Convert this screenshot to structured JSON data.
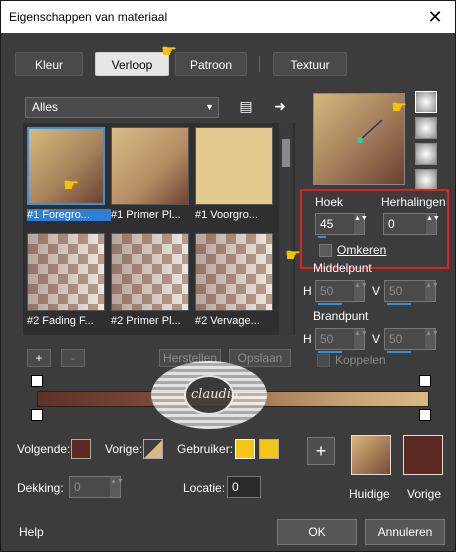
{
  "window": {
    "title": "Eigenschappen van materiaal",
    "close_glyph": "✕"
  },
  "tabs": [
    {
      "label": "Kleur"
    },
    {
      "label": "Verloop",
      "active": true
    },
    {
      "label": "Patroon"
    },
    {
      "label": "Textuur"
    }
  ],
  "library": {
    "category": "Alles",
    "items": [
      {
        "label": "#1 Foregro..."
      },
      {
        "label": "#1 Primer Pl..."
      },
      {
        "label": "#1 Voorgro..."
      },
      {
        "label": "#2 Fading F..."
      },
      {
        "label": "#2 Primer Pl..."
      },
      {
        "label": "#2 Vervage..."
      }
    ],
    "add_label": "+",
    "remove_label": "-",
    "reset_label": "Herstellen",
    "save_label": "Opslaan"
  },
  "gradient": {
    "hoek_label": "Hoek",
    "hoek_value": "45",
    "herhalingen_label": "Herhalingen",
    "herhalingen_value": "0",
    "omkeren_label": "Omkeren",
    "middelpunt_label": "Middelpunt",
    "middelpunt_h_label": "H",
    "middelpunt_h_value": "50",
    "middelpunt_v_label": "V",
    "middelpunt_v_value": "50",
    "brandpunt_label": "Brandpunt",
    "brandpunt_h_label": "H",
    "brandpunt_h_value": "50",
    "brandpunt_v_label": "V",
    "brandpunt_v_value": "50",
    "koppelen_label": "Koppelen"
  },
  "editor": {
    "volgende_label": "Volgende:",
    "vorige_label": "Vorige:",
    "gebruiker_label": "Gebruiker:",
    "dekking_label": "Dekking:",
    "dekking_value": "0",
    "locatie_label": "Locatie:",
    "locatie_value": "0"
  },
  "colors": {
    "huidige_label": "Huidige",
    "vorige_label": "Vorige",
    "accent": "#3b8ee0",
    "highlight_box": "#e02020",
    "gebruiker_color": "#f5c518",
    "vorige_color": "#5b2a22"
  },
  "watermark": {
    "text": "claudia"
  },
  "footer": {
    "help_label": "Help",
    "ok_label": "OK",
    "cancel_label": "Annuleren"
  }
}
